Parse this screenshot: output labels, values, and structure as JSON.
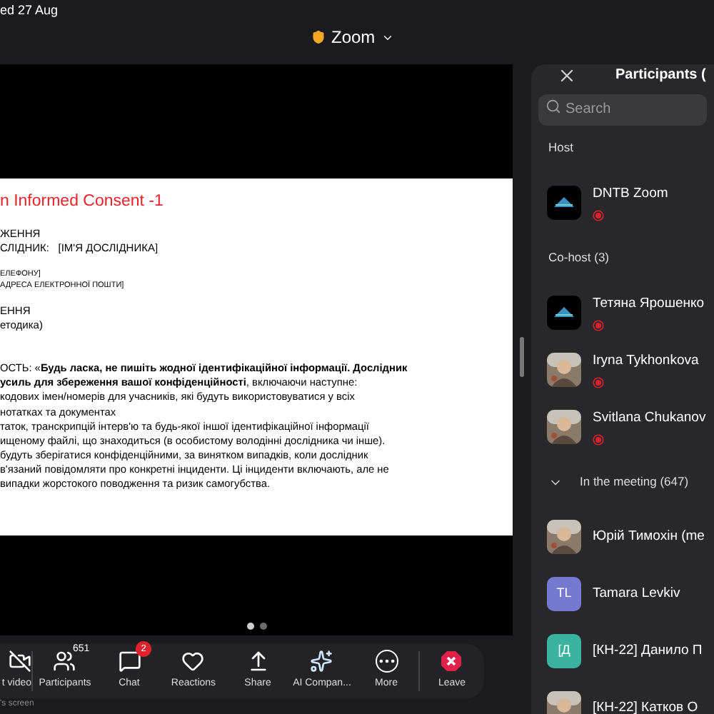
{
  "status_bar": {
    "date": "ed 27 Aug"
  },
  "meeting": {
    "title": "Zoom"
  },
  "slide": {
    "title": "n Informed Consent -1",
    "blocks": [
      {
        "kind": "heading",
        "lines": [
          "ЖЕННЯ",
          "СЛІДНИК:   [ІМ'Я ДОСЛІДНИКА]"
        ]
      },
      {
        "kind": "small",
        "lines": [
          "ЕЛЕФОНУ]",
          "АДРЕСА ЕЛЕКТРОННОЇ ПОШТИ]"
        ]
      },
      {
        "kind": "heading",
        "lines": [
          "ЕННЯ",
          "етодика)"
        ]
      },
      {
        "kind": "body",
        "lines": [
          "ОСТЬ: «**Будь ласка, не пишіть жодної ідентифікаційної інформації. Дослідник**",
          "**усиль для збереження вашої конфіденційності**, включаючи наступне:",
          "кодових імен/номерів для учасників, які будуть використовуватися у всіх",
          "нотатках та документах",
          "таток, транскрипцій інтерв'ю та будь-якої іншої ідентифікаційної інформації",
          "ищеному файлі, що знаходиться (в особистому володінні дослідника чи інше).",
          "будуть зберігатися конфіденційними, за винятком випадків, коли дослідник",
          "в'язаний повідомляти про конкретні інциденти. Ці інциденти включають, але не",
          "випадки жорстокого поводження та ризик самогубства."
        ]
      }
    ]
  },
  "pager": [
    {
      "selected": true
    },
    {
      "selected": false
    }
  ],
  "toolbar": [
    {
      "kind": "video",
      "label": "t video"
    },
    {
      "kind": "participants",
      "label": "Participants",
      "count": "651"
    },
    {
      "kind": "chat",
      "label": "Chat",
      "badge": "2"
    },
    {
      "kind": "reactions",
      "label": "Reactions"
    },
    {
      "kind": "share",
      "label": "Share"
    },
    {
      "kind": "ai",
      "label": "AI Compan..."
    },
    {
      "kind": "more",
      "label": "More"
    },
    {
      "kind": "leave",
      "label": "Leave"
    }
  ],
  "screen_caption": "'s screen",
  "participants_panel": {
    "title": "Participants (",
    "search": {
      "placeholder": "Search"
    },
    "sections": [
      {
        "title": "Host",
        "people": [
          {
            "name": "DNTB Zoom",
            "kind": "logo",
            "status_dot": true
          }
        ]
      },
      {
        "title": "Co-host (3)",
        "people": [
          {
            "name": "Тетяна Ярошенко",
            "kind": "logo",
            "status_dot": true
          },
          {
            "name": "Iryna Tykhonkova",
            "status_dot": true
          },
          {
            "name": "Svitlana Chukanov",
            "status_dot": true
          }
        ]
      },
      {
        "title": "In the meeting (647)",
        "expanded": true,
        "people": [
          {
            "name": "Юрій Тимохін (me",
            "status_dot": false
          },
          {
            "name": "Tamara Levkiv",
            "kind": "initials",
            "initials": "TL",
            "color": "#7579d0",
            "status_dot": false
          },
          {
            "name": "[КН-22] Данило П",
            "kind": "initials",
            "initials": "[Д",
            "color": "#3bb39f",
            "status_dot": false
          },
          {
            "name": "[КН-22] Катков О",
            "status_dot": false
          }
        ]
      }
    ]
  }
}
